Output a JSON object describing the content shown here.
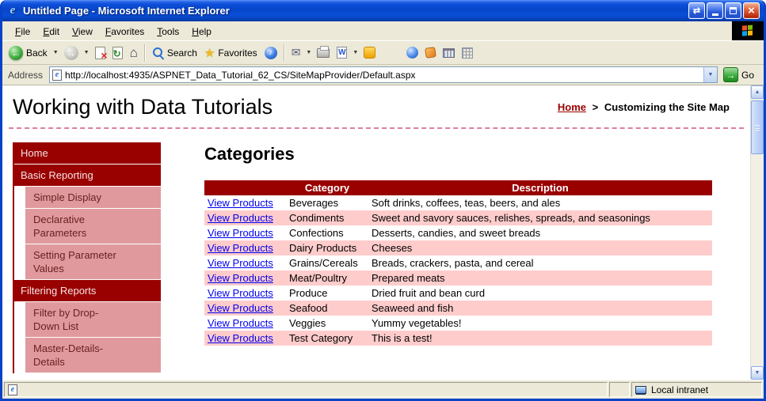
{
  "titlebar": {
    "title": "Untitled Page - Microsoft Internet Explorer"
  },
  "menubar": {
    "items": [
      "File",
      "Edit",
      "View",
      "Favorites",
      "Tools",
      "Help"
    ]
  },
  "toolbar": {
    "back": "Back",
    "search": "Search",
    "favorites": "Favorites"
  },
  "addressbar": {
    "label": "Address",
    "url": "http://localhost:4935/ASPNET_Data_Tutorial_62_CS/SiteMapProvider/Default.aspx",
    "go": "Go"
  },
  "content": {
    "header": {
      "title": "Working with Data Tutorials",
      "breadcrumb_home": "Home",
      "breadcrumb_sep": ">",
      "breadcrumb_current": "Customizing the Site Map"
    },
    "sidebar": [
      {
        "label": "Home",
        "level": 1
      },
      {
        "label": "Basic Reporting",
        "level": 1
      },
      {
        "label": "Simple Display",
        "level": 2
      },
      {
        "label": "Declarative Parameters",
        "level": 2
      },
      {
        "label": "Setting Parameter Values",
        "level": 2
      },
      {
        "label": "Filtering Reports",
        "level": 1
      },
      {
        "label": "Filter by Drop-Down List",
        "level": 2
      },
      {
        "label": "Master-Details-Details",
        "level": 2
      }
    ],
    "main": {
      "heading": "Categories",
      "table": {
        "headers": [
          "",
          "Category",
          "Description"
        ],
        "link_label": "View Products",
        "rows": [
          [
            "Beverages",
            "Soft drinks, coffees, teas, beers, and ales"
          ],
          [
            "Condiments",
            "Sweet and savory sauces, relishes, spreads, and seasonings"
          ],
          [
            "Confections",
            "Desserts, candies, and sweet breads"
          ],
          [
            "Dairy Products",
            "Cheeses"
          ],
          [
            "Grains/Cereals",
            "Breads, crackers, pasta, and cereal"
          ],
          [
            "Meat/Poultry",
            "Prepared meats"
          ],
          [
            "Produce",
            "Dried fruit and bean curd"
          ],
          [
            "Seafood",
            "Seaweed and fish"
          ],
          [
            "Veggies",
            "Yummy vegetables!"
          ],
          [
            "Test Category",
            "This is a test!"
          ]
        ]
      }
    }
  },
  "statusbar": {
    "zone": "Local intranet"
  },
  "icons": {
    "back": "green-circle-left-arrow",
    "forward": "gray-circle-right-arrow",
    "stop": "page-with-red-x",
    "refresh": "page-with-green-arrows",
    "home": "house",
    "search": "magnifier",
    "favorites": "gold-star",
    "media": "blue-circle-note",
    "mail": "envelope",
    "print": "printer",
    "edit_word": "word-w-page",
    "windows_logo": "four-color-flag",
    "local_intranet": "computer-monitor"
  },
  "colors": {
    "maroon": "#990000",
    "row_alt": "#ffcccc",
    "sidebar_sub_bg": "#e09a9e",
    "sidebar_sub_text": "#6b2020",
    "sidebar_text": "#f6e3e3",
    "link_blue": "#0000ee",
    "dashed_pink": "#de7ba6",
    "chrome_tan": "#ece9d8"
  }
}
